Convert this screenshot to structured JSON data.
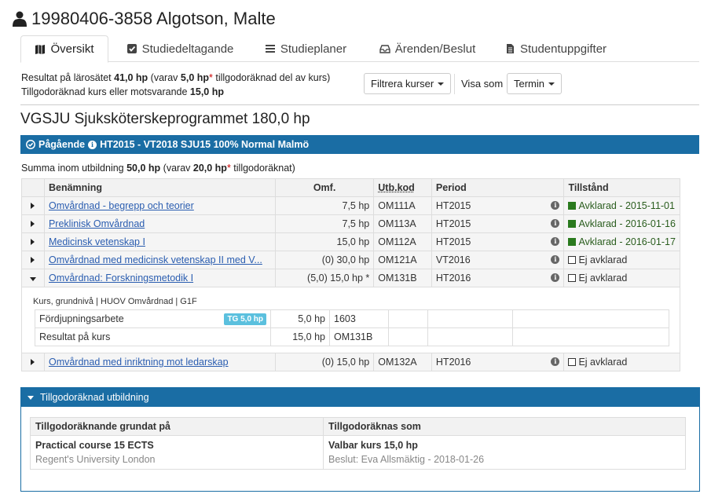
{
  "header": {
    "title": "19980406-3858 Algotson, Malte"
  },
  "tabs": [
    {
      "label": "Översikt",
      "icon": "map-icon"
    },
    {
      "label": "Studiedeltagande",
      "icon": "checkbox-icon"
    },
    {
      "label": "Studieplaner",
      "icon": "list-icon"
    },
    {
      "label": "Ärenden/Beslut",
      "icon": "inbox-icon"
    },
    {
      "label": "Studentuppgifter",
      "icon": "file-icon"
    }
  ],
  "summary": {
    "line1_a": "Resultat på lärosätet ",
    "line1_b": "41,0 hp",
    "line1_c": " (varav ",
    "line1_d": "5,0 hp",
    "line1_e": "*",
    "line1_f": " tillgodoräknad del av kurs)",
    "line2_a": "Tillgodoräknad kurs eller motsvarande ",
    "line2_b": "15,0 hp"
  },
  "filter": {
    "button": "Filtrera kurser",
    "visa_label": "Visa som",
    "visa_value": "Termin"
  },
  "program": {
    "title": "VGSJU Sjuksköterskeprogrammet 180,0 hp",
    "status_bar": "Pågående",
    "status_text": "HT2015 - VT2018 SJU15 100% Normal Malmö",
    "summa_a": "Summa inom utbildning ",
    "summa_b": "50,0 hp",
    "summa_c": " (varav ",
    "summa_d": "20,0 hp",
    "summa_e": "*",
    "summa_f": " tillgodoräknat)"
  },
  "table": {
    "headers": [
      "Benämning",
      "Omf.",
      "Utb.kod",
      "Period",
      "Tillstånd"
    ],
    "rows": [
      {
        "name": "Omvårdnad - begrepp och teorier",
        "omf": "7,5 hp",
        "kod": "OM111A",
        "period": "HT2015",
        "state": "Avklarad - 2015-11-01"
      },
      {
        "name": "Preklinisk Omvårdnad",
        "omf": "7,5 hp",
        "kod": "OM113A",
        "period": "HT2015",
        "state": "Avklarad - 2016-01-16"
      },
      {
        "name": "Medicinsk vetenskap I",
        "omf": "15,0 hp",
        "kod": "OM112A",
        "period": "HT2015",
        "state": "Avklarad - 2016-01-17"
      },
      {
        "name": "Omvårdnad med medicinsk vetenskap II med V...",
        "omf": "(0) 30,0 hp",
        "kod": "OM121A",
        "period": "VT2016",
        "state": "Ej avklarad"
      },
      {
        "name": "Omvårdnad: Forskningsmetodik I",
        "omf": "(5,0) 15,0 hp *",
        "kod": "OM131B",
        "period": "HT2016",
        "state": "Ej avklarad"
      },
      {
        "name": "Omvårdnad med inriktning mot ledarskap",
        "omf": "(0) 15,0 hp",
        "kod": "OM132A",
        "period": "HT2016",
        "state": "Ej avklarad"
      }
    ],
    "detail": {
      "subhead": "Kurs, grundnivå | HUOV Omvårdnad | G1F",
      "rows": [
        {
          "name": "Fördjupningsarbete",
          "badge": "TG 5,0 hp",
          "omf": "5,0 hp",
          "kod": "1603"
        },
        {
          "name": "Resultat på kurs",
          "omf": "15,0 hp",
          "kod": "OM131B"
        }
      ]
    }
  },
  "credit": {
    "title": "Tillgodoräknad utbildning",
    "headers": [
      "Tillgodoräknande grundat på",
      "Tillgodoräknas som"
    ],
    "basis_name": "Practical course 15 ECTS",
    "basis_school": "Regent's University London",
    "as_name": "Valbar kurs 15,0 hp",
    "as_decision": "Beslut: Eva Allsmäktig - 2018-01-26"
  },
  "colors": {
    "accent": "#1a6da4",
    "link": "#2a5db0",
    "done": "#2a7a1e"
  }
}
